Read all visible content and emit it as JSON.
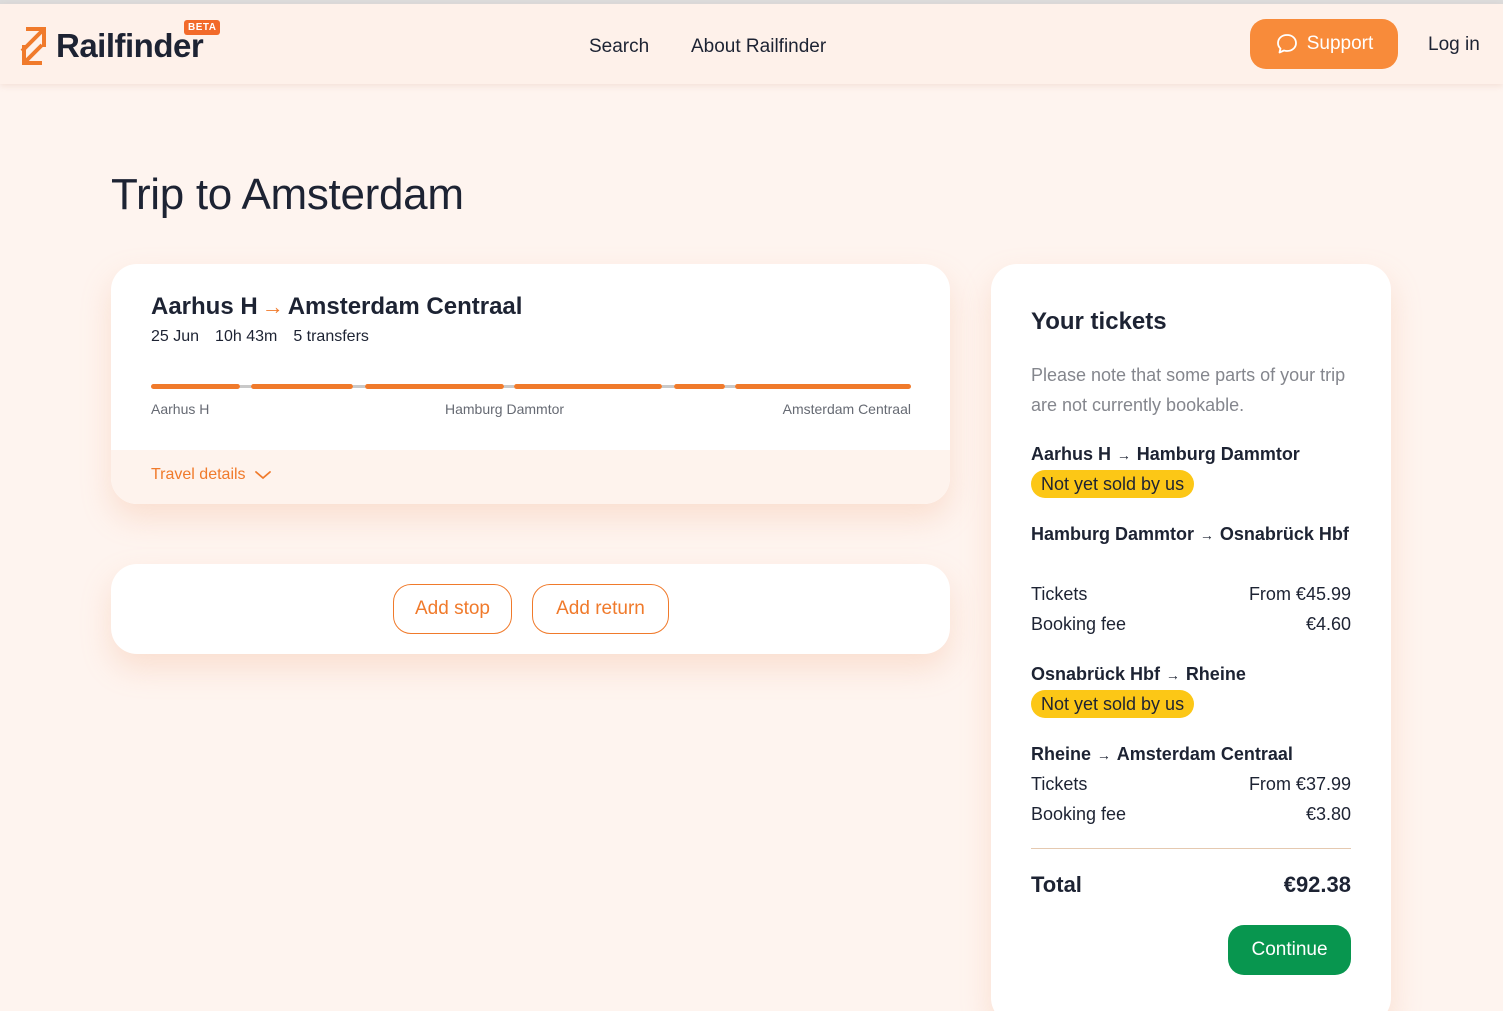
{
  "header": {
    "logo_text": "Railfinder",
    "beta_label": "BETA",
    "nav": {
      "search": "Search",
      "about": "About Railfinder"
    },
    "support_label": "Support",
    "login_label": "Log in"
  },
  "page_title": "Trip to Amsterdam",
  "trip": {
    "origin": "Aarhus H",
    "destination": "Amsterdam Centraal",
    "date": "25 Jun",
    "duration": "10h 43m",
    "transfers": "5 transfers",
    "stops": {
      "start": "Aarhus H",
      "middle": "Hamburg Dammtor",
      "end": "Amsterdam Centraal"
    },
    "details_label": "Travel details"
  },
  "actions": {
    "add_stop": "Add stop",
    "add_return": "Add return"
  },
  "tickets": {
    "title": "Your tickets",
    "note": "Please note that some parts of your trip are not currently bookable.",
    "legs": [
      {
        "from": "Aarhus H",
        "to": "Hamburg Dammtor",
        "badge": "Not yet sold by us"
      },
      {
        "from": "Hamburg Dammtor",
        "to": "Osnabrück Hbf",
        "tickets_label": "Tickets",
        "tickets_price": "From €45.99",
        "fee_label": "Booking fee",
        "fee_price": "€4.60"
      },
      {
        "from": "Osnabrück Hbf",
        "to": "Rheine",
        "badge": "Not yet sold by us"
      },
      {
        "from": "Rheine",
        "to": "Amsterdam Centraal",
        "tickets_label": "Tickets",
        "tickets_price": "From €37.99",
        "fee_label": "Booking fee",
        "fee_price": "€3.80"
      }
    ],
    "total_label": "Total",
    "total_value": "€92.38",
    "continue_label": "Continue"
  },
  "colors": {
    "accent": "#f07a2b",
    "badge": "#fcc716",
    "continue": "#08964f"
  }
}
